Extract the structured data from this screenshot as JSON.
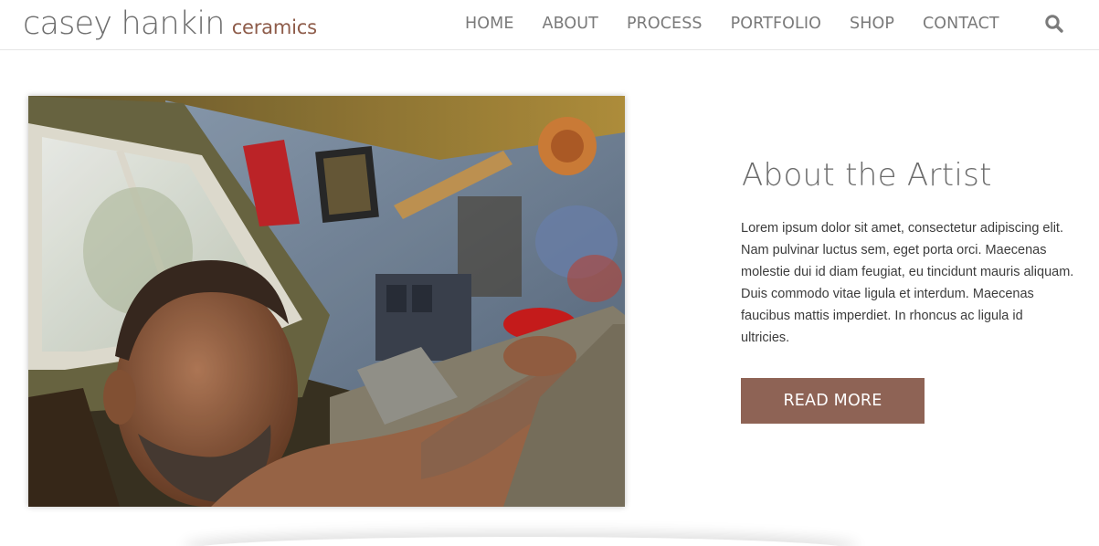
{
  "logo": {
    "name": "casey hankin",
    "sub": "ceramics"
  },
  "nav": {
    "items": [
      {
        "label": "HOME"
      },
      {
        "label": "ABOUT"
      },
      {
        "label": "PROCESS"
      },
      {
        "label": "PORTFOLIO"
      },
      {
        "label": "SHOP"
      },
      {
        "label": "CONTACT"
      }
    ],
    "search_icon": "search-icon"
  },
  "about": {
    "heading": "About the Artist",
    "body": "Lorem ipsum dolor sit amet, consectetur adipiscing elit. Nam pulvinar luctus sem, eget porta orci. Maecenas molestie dui id diam feugiat, eu tincidunt mauris aliquam. Duis commodo vitae ligula et interdum. Maecenas faucibus mattis imperdiet. In rhoncus ac ligula id ultricies.",
    "button": "READ MORE"
  },
  "colors": {
    "accent": "#8e6355",
    "logo_sub": "#8e5c4a",
    "nav_text": "#7a7a7a",
    "heading": "#6b6b6b"
  }
}
